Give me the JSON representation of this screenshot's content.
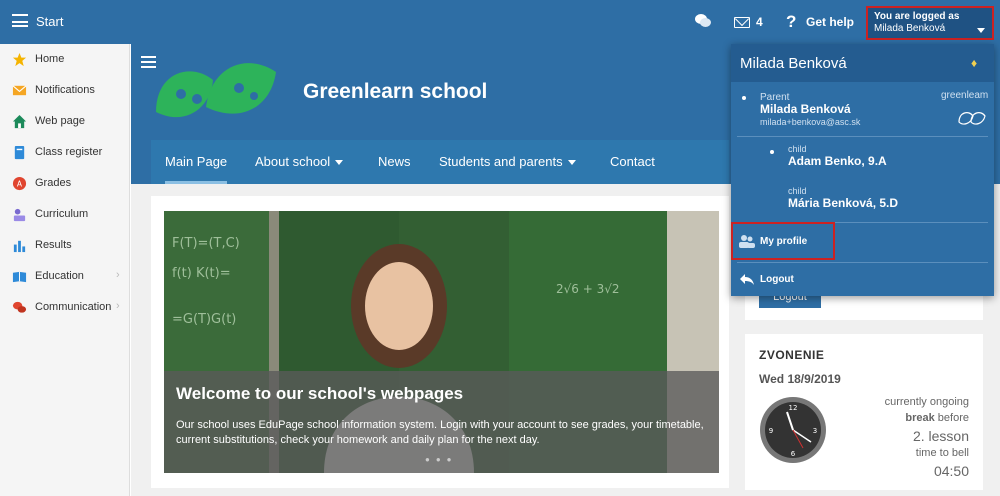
{
  "topbar": {
    "start_label": "Start",
    "mail_count": "4",
    "help_label": "Get help",
    "logged_label": "You are logged as",
    "logged_user": "Milada Benková"
  },
  "sidebar": {
    "items": [
      {
        "label": "Home",
        "icon": "star-icon"
      },
      {
        "label": "Notifications",
        "icon": "envelope-icon"
      },
      {
        "label": "Web page",
        "icon": "house-icon"
      },
      {
        "label": "Class register",
        "icon": "notebook-icon"
      },
      {
        "label": "Grades",
        "icon": "grades-icon"
      },
      {
        "label": "Curriculum",
        "icon": "curriculum-icon"
      },
      {
        "label": "Results",
        "icon": "bar-chart-icon"
      },
      {
        "label": "Education",
        "icon": "book-icon"
      },
      {
        "label": "Communication",
        "icon": "chat-bubbles-icon"
      }
    ]
  },
  "header": {
    "school_name": "Greenlearn school",
    "menu": [
      "Main Page",
      "About school",
      "News",
      "Students and parents",
      "Contact"
    ]
  },
  "hero": {
    "title": "Welcome to our school's webpages",
    "text": "Our school uses EduPage school information system. Login with your account to see grades, your timetable, current substitutions, check your homework and daily plan for the next day."
  },
  "login_button": "Logout",
  "zvonenie": {
    "title": "ZVONENIE",
    "date": "Wed 18/9/2019",
    "line1": "currently ongoing",
    "line2_bold": "break",
    "line2_rest": "before",
    "line3": "2. lesson",
    "line4": "time to bell",
    "line5": "04:50"
  },
  "dropdown": {
    "name": "Milada Benková",
    "parent_label": "Parent",
    "parent_name": "Milada Benková",
    "parent_email": "milada+benkova@asc.sk",
    "brand": "greenleam",
    "children": [
      {
        "label": "child",
        "name": "Adam Benko, 9.A"
      },
      {
        "label": "child",
        "name": "Mária Benková, 5.D"
      }
    ],
    "my_profile": "My profile",
    "logout": "Logout"
  },
  "colors": {
    "primary": "#2e6ea5",
    "highlight": "#cc2222",
    "sidebar_bg": "#f5f5f5"
  }
}
